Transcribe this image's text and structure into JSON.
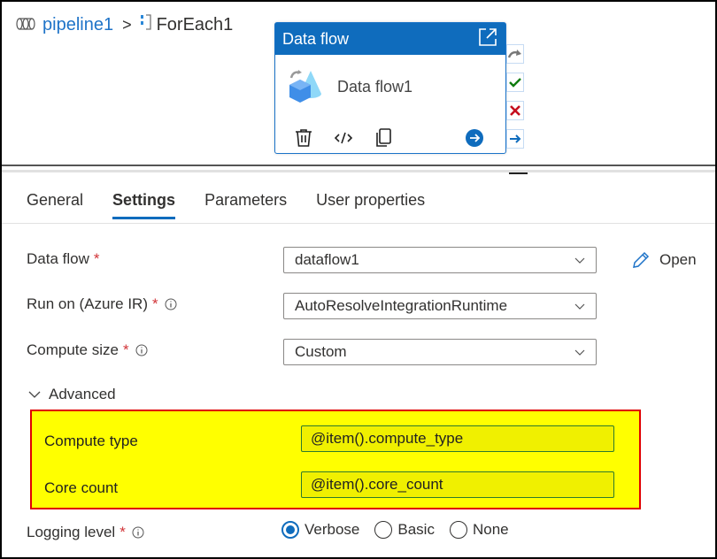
{
  "breadcrumb": {
    "pipeline": "pipeline1",
    "separator": ">",
    "current": "ForEach1"
  },
  "activity_card": {
    "type_title": "Data flow",
    "name": "Data flow1",
    "actions": [
      "delete-icon",
      "code-icon",
      "copy-icon",
      "go-arrow-icon"
    ],
    "side_icons": [
      "skip-icon",
      "success-icon",
      "failure-icon",
      "completion-icon"
    ]
  },
  "tabs": [
    {
      "label": "General",
      "active": false
    },
    {
      "label": "Settings",
      "active": true
    },
    {
      "label": "Parameters",
      "active": false
    },
    {
      "label": "User properties",
      "active": false
    }
  ],
  "settings": {
    "data_flow": {
      "label": "Data flow",
      "required": "*",
      "value": "dataflow1"
    },
    "open_label": "Open",
    "run_on": {
      "label": "Run on (Azure IR)",
      "required": "*",
      "value": "AutoResolveIntegrationRuntime"
    },
    "compute_size": {
      "label": "Compute size",
      "required": "*",
      "value": "Custom"
    },
    "advanced_label": "Advanced",
    "compute_type": {
      "label": "Compute type",
      "value": "@item().compute_type"
    },
    "core_count": {
      "label": "Core count",
      "value": "@item().core_count"
    },
    "logging_level": {
      "label": "Logging level",
      "required": "*",
      "options": [
        {
          "label": "Verbose",
          "selected": true
        },
        {
          "label": "Basic",
          "selected": false
        },
        {
          "label": "None",
          "selected": false
        }
      ]
    }
  },
  "colors": {
    "accent": "#0f6cbd",
    "link": "#1e73c8",
    "required": "#d13438",
    "highlight_fill": "#ffff00",
    "highlight_border": "#e00000"
  }
}
